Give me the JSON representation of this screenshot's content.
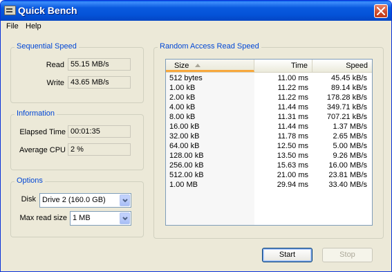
{
  "window": {
    "title": "Quick Bench"
  },
  "menu": {
    "file": "File",
    "help": "Help"
  },
  "sequential": {
    "title": "Sequential Speed",
    "read_label": "Read",
    "read_value": "55.15 MB/s",
    "write_label": "Write",
    "write_value": "43.65 MB/s"
  },
  "information": {
    "title": "Information",
    "elapsed_label": "Elapsed Time",
    "elapsed_value": "00:01:35",
    "cpu_label": "Average CPU",
    "cpu_value": "2 %"
  },
  "options": {
    "title": "Options",
    "disk_label": "Disk",
    "disk_value": "Drive 2 (160.0 GB)",
    "maxread_label": "Max read size",
    "maxread_value": "1 MB"
  },
  "random": {
    "title": "Random Access Read Speed",
    "columns": {
      "size": "Size",
      "time": "Time",
      "speed": "Speed"
    },
    "rows": [
      {
        "size": "512 bytes",
        "time": "11.00 ms",
        "speed": "45.45 kB/s"
      },
      {
        "size": "1.00 kB",
        "time": "11.22 ms",
        "speed": "89.14 kB/s"
      },
      {
        "size": "2.00 kB",
        "time": "11.22 ms",
        "speed": "178.28 kB/s"
      },
      {
        "size": "4.00 kB",
        "time": "11.44 ms",
        "speed": "349.71 kB/s"
      },
      {
        "size": "8.00 kB",
        "time": "11.31 ms",
        "speed": "707.21 kB/s"
      },
      {
        "size": "16.00 kB",
        "time": "11.44 ms",
        "speed": "1.37 MB/s"
      },
      {
        "size": "32.00 kB",
        "time": "11.78 ms",
        "speed": "2.65 MB/s"
      },
      {
        "size": "64.00 kB",
        "time": "12.50 ms",
        "speed": "5.00 MB/s"
      },
      {
        "size": "128.00 kB",
        "time": "13.50 ms",
        "speed": "9.26 MB/s"
      },
      {
        "size": "256.00 kB",
        "time": "15.63 ms",
        "speed": "16.00 MB/s"
      },
      {
        "size": "512.00 kB",
        "time": "21.00 ms",
        "speed": "23.81 MB/s"
      },
      {
        "size": "1.00 MB",
        "time": "29.94 ms",
        "speed": "33.40 MB/s"
      }
    ]
  },
  "buttons": {
    "start": "Start",
    "stop": "Stop"
  },
  "colors": {
    "titlebar": "#0a5adf",
    "group_title": "#0046d5",
    "sort_indicator": "#f8a83c",
    "face": "#ece9d8"
  }
}
